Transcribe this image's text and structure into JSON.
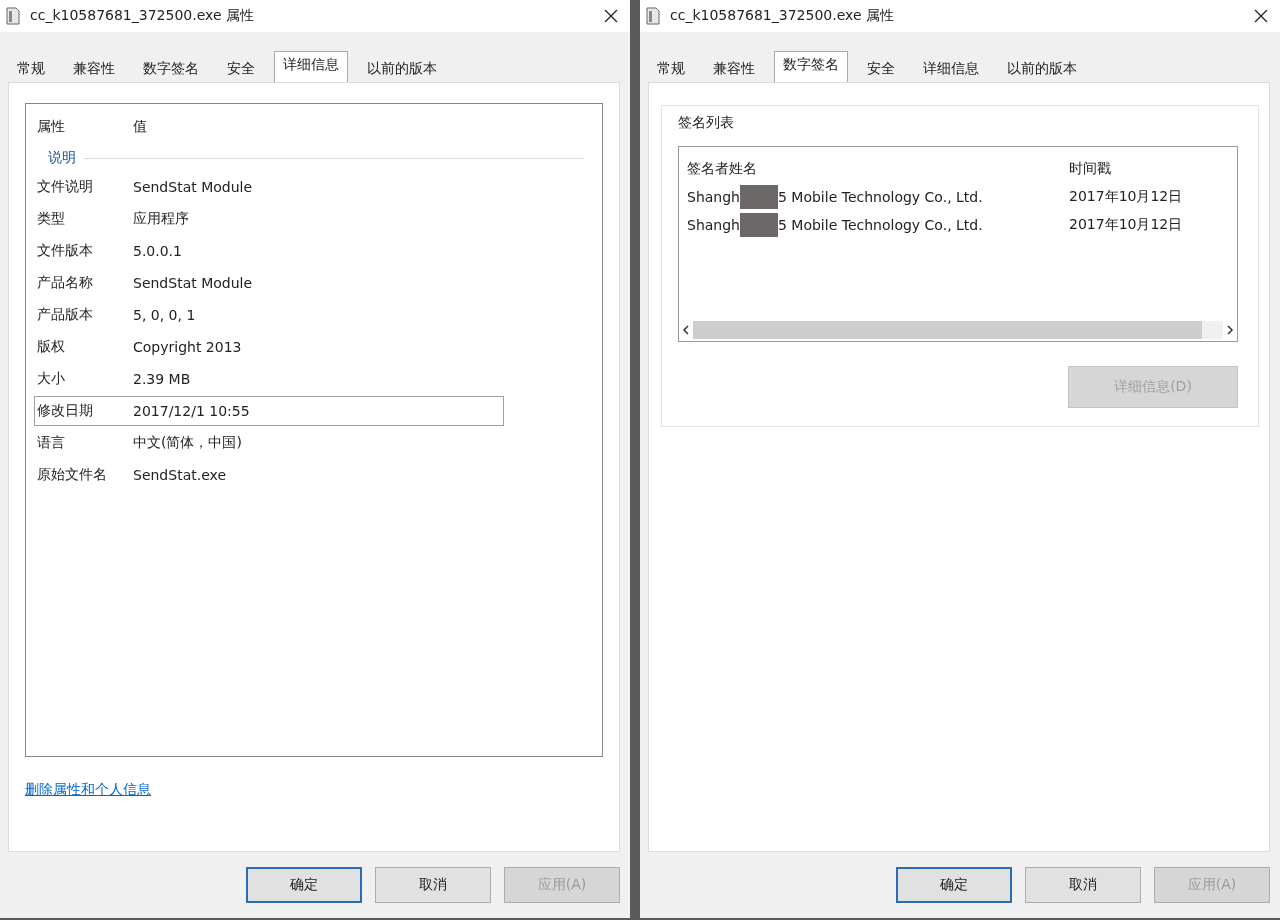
{
  "dialogs": [
    {
      "title": "cc_k10587681_372500.exe 属性",
      "kind": "details",
      "tabs": [
        {
          "label": "常规",
          "selected": false
        },
        {
          "label": "兼容性",
          "selected": false
        },
        {
          "label": "数字签名",
          "selected": false
        },
        {
          "label": "安全",
          "selected": false
        },
        {
          "label": "详细信息",
          "selected": true
        },
        {
          "label": "以前的版本",
          "selected": false
        }
      ],
      "details": {
        "columns": [
          "属性",
          "值"
        ],
        "section": "说明",
        "rows": [
          {
            "label": "文件说明",
            "value": "SendStat Module",
            "selected": false
          },
          {
            "label": "类型",
            "value": "应用程序",
            "selected": false
          },
          {
            "label": "文件版本",
            "value": "5.0.0.1",
            "selected": false
          },
          {
            "label": "产品名称",
            "value": "SendStat Module",
            "selected": false
          },
          {
            "label": "产品版本",
            "value": "5, 0, 0, 1",
            "selected": false
          },
          {
            "label": "版权",
            "value": "Copyright 2013",
            "selected": false
          },
          {
            "label": "大小",
            "value": "2.39 MB",
            "selected": false
          },
          {
            "label": "修改日期",
            "value": "2017/12/1 10:55",
            "selected": true
          },
          {
            "label": "语言",
            "value": "中文(简体，中国)",
            "selected": false
          },
          {
            "label": "原始文件名",
            "value": "SendStat.exe",
            "selected": false
          }
        ],
        "link": "删除属性和个人信息"
      },
      "buttons": [
        {
          "label": "确定",
          "default": true,
          "disabled": false
        },
        {
          "label": "取消",
          "default": false,
          "disabled": false
        },
        {
          "label": "应用(A)",
          "default": false,
          "disabled": true
        }
      ]
    },
    {
      "title": "cc_k10587681_372500.exe 属性",
      "kind": "signatures",
      "tabs": [
        {
          "label": "常规",
          "selected": false
        },
        {
          "label": "兼容性",
          "selected": false
        },
        {
          "label": "数字签名",
          "selected": true
        },
        {
          "label": "安全",
          "selected": false
        },
        {
          "label": "详细信息",
          "selected": false
        },
        {
          "label": "以前的版本",
          "selected": false
        }
      ],
      "signatures": {
        "group_title": "签名列表",
        "columns": [
          "签名者姓名",
          "时间戳"
        ],
        "rows": [
          {
            "name_start": "Shangh",
            "name_end": "5 Mobile Technology Co., Ltd.",
            "timestamp": "2017年10月12日"
          },
          {
            "name_start": "Shangh",
            "name_end": "5 Mobile Technology Co., Ltd.",
            "timestamp": "2017年10月12日"
          }
        ],
        "details_button": {
          "label": "详细信息(D)",
          "disabled": true
        }
      },
      "buttons": [
        {
          "label": "确定",
          "default": true,
          "disabled": false
        },
        {
          "label": "取消",
          "default": false,
          "disabled": false
        },
        {
          "label": "应用(A)",
          "default": false,
          "disabled": true
        }
      ]
    }
  ]
}
